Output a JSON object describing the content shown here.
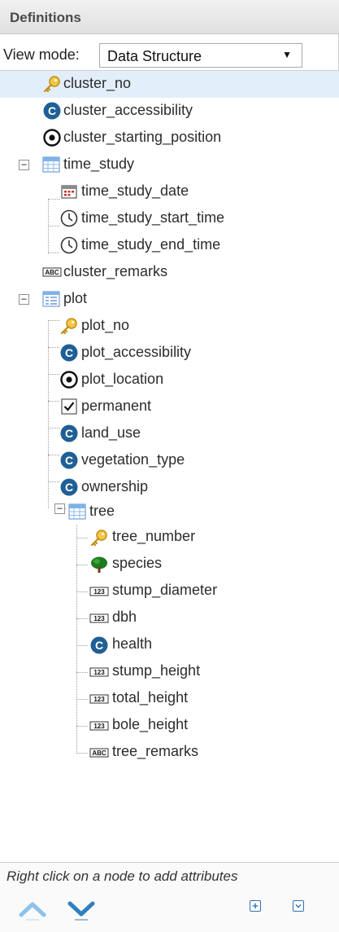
{
  "panel": {
    "title": "Definitions"
  },
  "view_mode": {
    "label": "View mode:",
    "selected": "Data Structure",
    "caret": "▼"
  },
  "tree": {
    "cluster_no": "cluster_no",
    "cluster_accessibility": "cluster_accessibility",
    "cluster_starting_position": "cluster_starting_position",
    "time_study": "time_study",
    "time_study_date": "time_study_date",
    "time_study_start_time": "time_study_start_time",
    "time_study_end_time": "time_study_end_time",
    "cluster_remarks": "cluster_remarks",
    "plot": "plot",
    "plot_no": "plot_no",
    "plot_accessibility": "plot_accessibility",
    "plot_location": "plot_location",
    "permanent": "permanent",
    "land_use": "land_use",
    "vegetation_type": "vegetation_type",
    "ownership": "ownership",
    "tree": "tree",
    "tree_number": "tree_number",
    "species": "species",
    "stump_diameter": "stump_diameter",
    "dbh": "dbh",
    "health": "health",
    "stump_height": "stump_height",
    "total_height": "total_height",
    "bole_height": "bole_height",
    "tree_remarks": "tree_remarks"
  },
  "icon_text": {
    "code": "C",
    "number": "123",
    "text": "ABC"
  },
  "expanders": {
    "collapse": "−"
  },
  "footer": {
    "hint": "Right click on a node to add attributes"
  },
  "colors": {
    "selection": "#e3eefb",
    "code_icon": "#1f5f95",
    "key_icon": "#e7b52f",
    "accent": "#2f6fb2"
  }
}
